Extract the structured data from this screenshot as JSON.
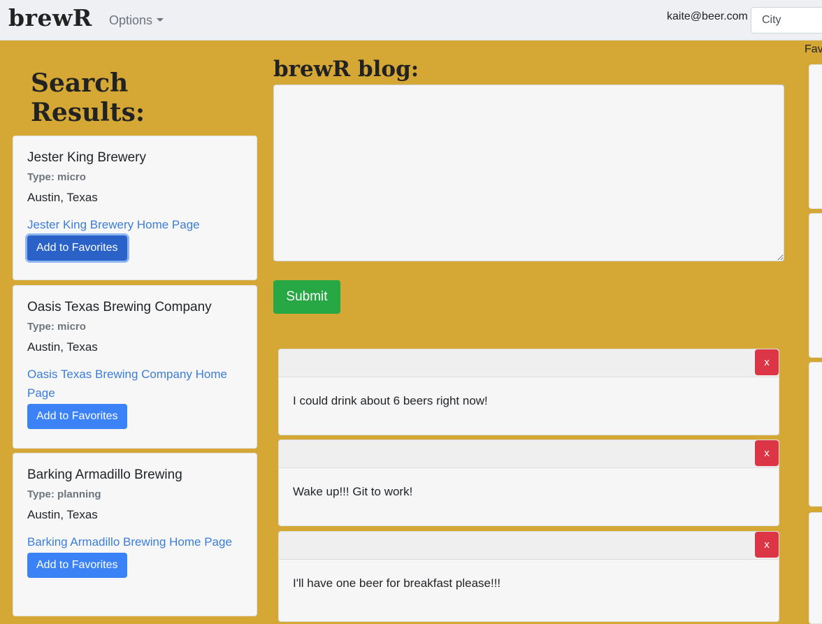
{
  "nav": {
    "brand": "brewR",
    "options_label": "Options",
    "user_email": "kaite@beer.com",
    "city_placeholder": "City"
  },
  "favorites": {
    "label": "Fav"
  },
  "search": {
    "title": "Search Results:",
    "add_label": "Add to Favorites",
    "results": [
      {
        "name": "Jester King Brewery",
        "type": "Type: micro",
        "location": "Austin, Texas",
        "link": "Jester King Brewery Home Page"
      },
      {
        "name": "Oasis Texas Brewing Company",
        "type": "Type: micro",
        "location": "Austin, Texas",
        "link": "Oasis Texas Brewing Company Home Page"
      },
      {
        "name": "Barking Armadillo Brewing",
        "type": "Type: planning",
        "location": "Austin, Texas",
        "link": "Barking Armadillo Brewing Home Page"
      }
    ]
  },
  "blog": {
    "title": "brewR blog:",
    "submit_label": "Submit",
    "delete_label": "x",
    "posts": [
      {
        "text": "I could drink about 6 beers right now!"
      },
      {
        "text": "Wake up!!! Git to work!"
      },
      {
        "text": "I'll have one beer for breakfast please!!!"
      }
    ]
  },
  "colors": {
    "background": "#d5a836",
    "primary": "#3b82f6",
    "success": "#28a745",
    "danger": "#dc3545",
    "link": "#3b7dd8"
  }
}
